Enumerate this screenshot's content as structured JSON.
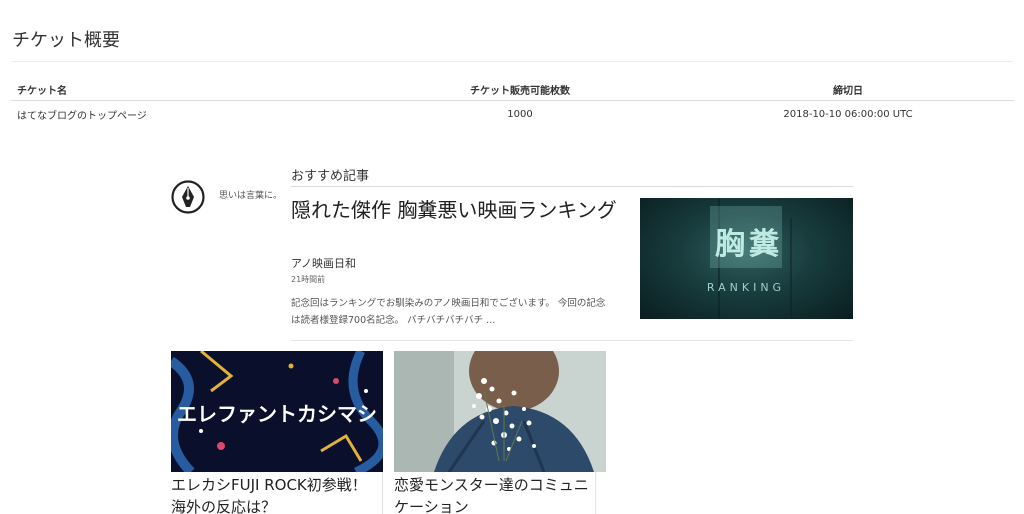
{
  "header": {
    "title": "チケット概要"
  },
  "ticket_table": {
    "columns": [
      "チケット名",
      "チケット販売可能枚数",
      "締切日"
    ],
    "rows": [
      [
        "はてなブログのトップページ",
        "1000",
        "2018-10-10 06:00:00 UTC"
      ]
    ]
  },
  "recommend": {
    "tagline": "思いは言葉に。",
    "heading": "おすすめ記事",
    "featured": {
      "title": "隠れた傑作 胸糞悪い映画ランキング",
      "blog": "アノ映画日和",
      "time": "21時間前",
      "excerpt": "記念回はランキングでお馴染みのアノ映画日和でございます。 今回の記念は読者様登録700名記念。 バチバチバチバチ ...",
      "thumb_text_1": "胸",
      "thumb_text_2": "糞",
      "thumb_subtext": "RANKING"
    },
    "cards": [
      {
        "title": "エレカシFUJI ROCK初参戦！海外の反応は？",
        "thumb_text": "エレファントカシマシ"
      },
      {
        "title": "恋愛モンスター達のコミュニケーション"
      }
    ]
  },
  "colors": {
    "text": "#333333",
    "rule": "#ececec",
    "featured_thumb": "#1d4445",
    "card1_bg": "#0a0f2c"
  },
  "icons": {
    "logo": "pen-nib-icon"
  }
}
